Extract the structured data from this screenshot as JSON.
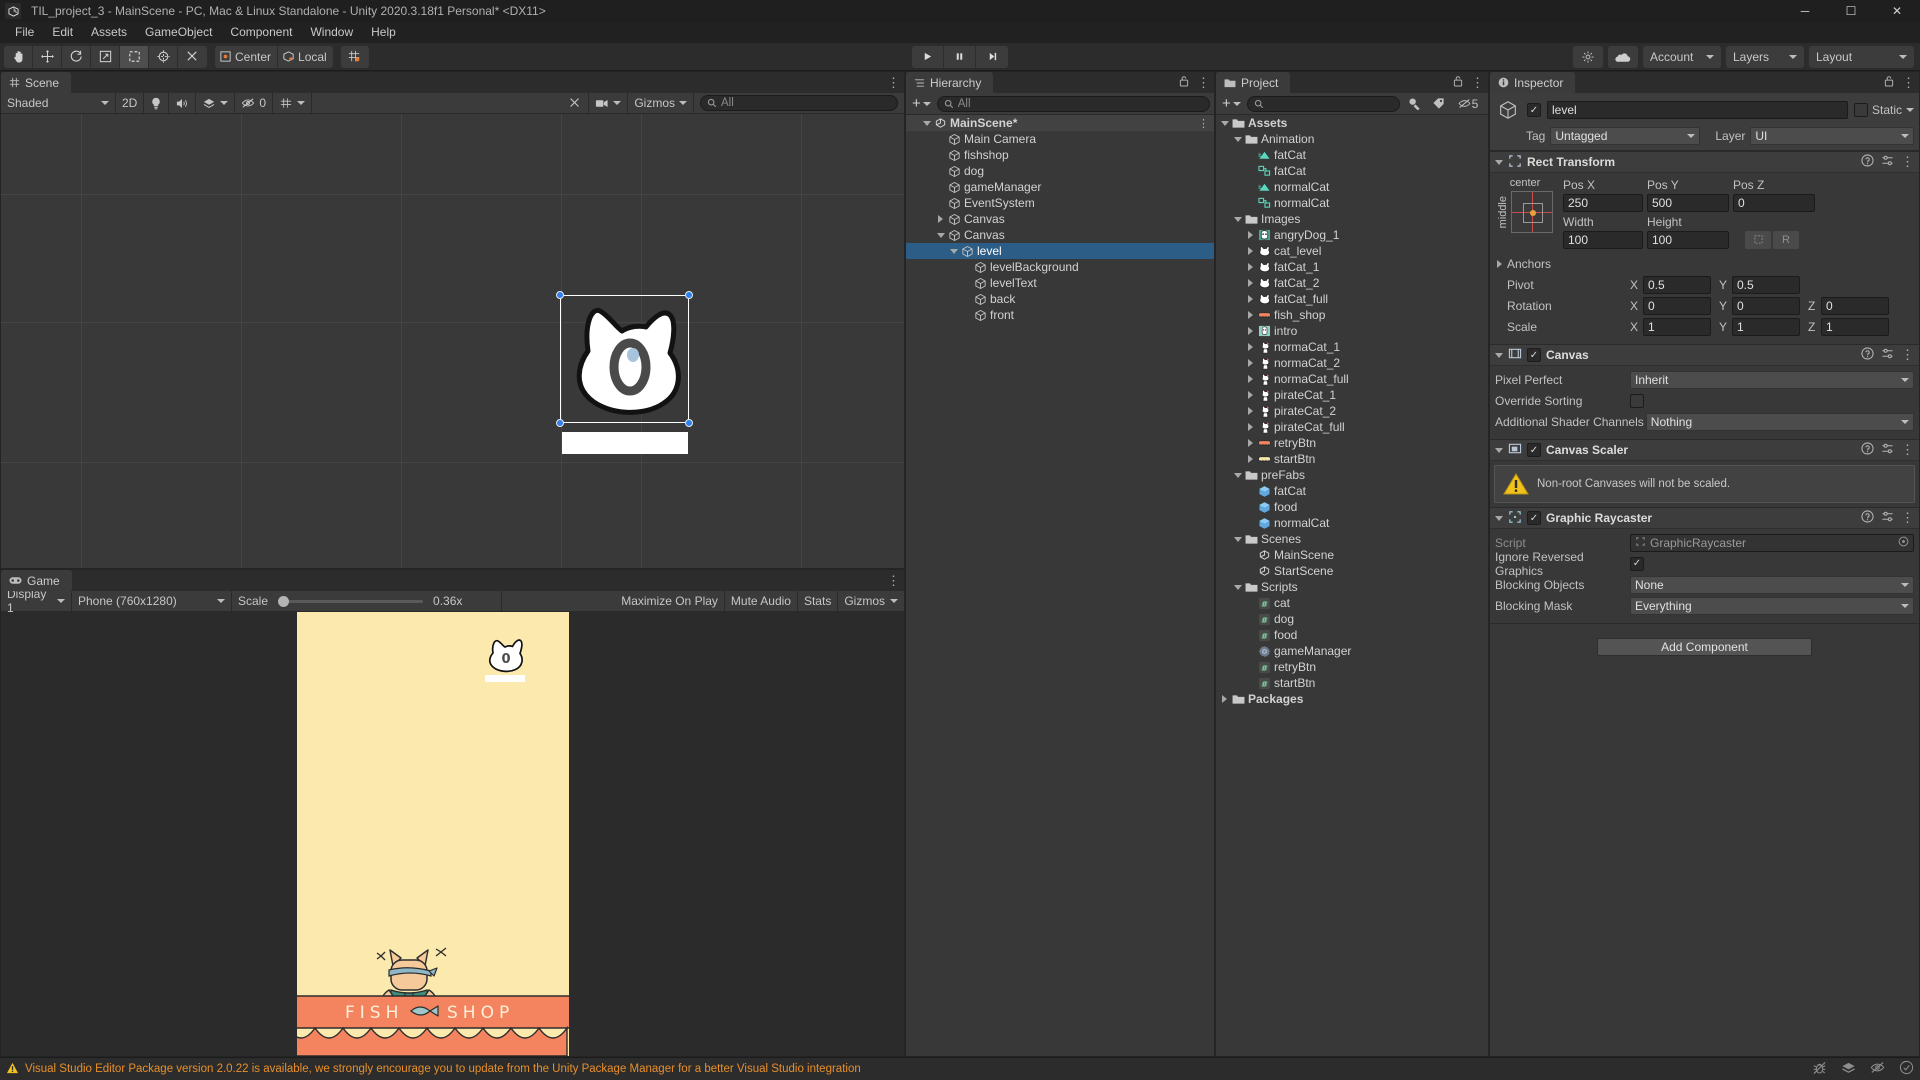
{
  "window": {
    "title": "TIL_project_3 - MainScene - PC, Mac & Linux Standalone - Unity 2020.3.18f1 Personal* <DX11>",
    "minimize": "─",
    "maximize": "☐",
    "close": "✕"
  },
  "menubar": {
    "items": [
      "File",
      "Edit",
      "Assets",
      "GameObject",
      "Component",
      "Window",
      "Help"
    ]
  },
  "toolbar": {
    "tools": [
      {
        "name": "hand-tool",
        "glyph": "✋",
        "active": false
      },
      {
        "name": "move-tool",
        "glyph": "✥",
        "active": false
      },
      {
        "name": "rotate-tool",
        "glyph": "↻",
        "active": false
      },
      {
        "name": "scale-tool",
        "glyph": "⬈",
        "active": false
      },
      {
        "name": "rect-tool",
        "glyph": "⬚",
        "active": true
      },
      {
        "name": "transform-tool",
        "glyph": "⊕",
        "active": false
      },
      {
        "name": "custom-tool",
        "glyph": "⚒",
        "active": false
      }
    ],
    "pivot_mode": "Center",
    "pivot_rotation": "Local",
    "grid_snap": "grid-snap-icon",
    "play": "▶",
    "pause": "▐▌",
    "step": "▶│",
    "cloud": "☁",
    "account": "Account",
    "layers": "Layers",
    "layout": "Layout",
    "search_glyph": "●"
  },
  "scene": {
    "tab_label": "Scene",
    "tab_icon": "#",
    "draw_mode": "Shaded",
    "mode_2d": "2D",
    "lighting_icon": "💡",
    "audio_icon": "🔊",
    "fx_icon": "fx-icon",
    "hidden_count": "0",
    "grid_icon": "grid-icon",
    "tools_icon": "⚒",
    "camera_icon": "▮",
    "gizmos_label": "Gizmos",
    "search_placeholder": "All",
    "sprite_label": "0"
  },
  "game": {
    "tab_label": "Game",
    "display": "Display 1",
    "aspect": "Phone (760x1280)",
    "scale_label": "Scale",
    "scale_value": "0.36x",
    "maximize": "Maximize On Play",
    "mute": "Mute Audio",
    "stats": "Stats",
    "gizmos": "Gizmos",
    "cat_counter": "0",
    "shop_sign": "F I S H   S H O P"
  },
  "hierarchy": {
    "tab_label": "Hierarchy",
    "tab_icon": "☰",
    "search_placeholder": "All",
    "scene_name": "MainScene*",
    "items": [
      {
        "label": "Main Camera",
        "depth": 2,
        "icon": "gameobject-icon",
        "arrow": "none",
        "selected": false
      },
      {
        "label": "fishshop",
        "depth": 2,
        "icon": "gameobject-icon",
        "arrow": "none",
        "selected": false
      },
      {
        "label": "dog",
        "depth": 2,
        "icon": "gameobject-icon",
        "arrow": "none",
        "selected": false
      },
      {
        "label": "gameManager",
        "depth": 2,
        "icon": "gameobject-icon",
        "arrow": "none",
        "selected": false
      },
      {
        "label": "EventSystem",
        "depth": 2,
        "icon": "gameobject-icon",
        "arrow": "none",
        "selected": false
      },
      {
        "label": "Canvas",
        "depth": 2,
        "icon": "gameobject-icon",
        "arrow": "closed",
        "selected": false
      },
      {
        "label": "Canvas",
        "depth": 2,
        "icon": "gameobject-icon",
        "arrow": "open",
        "selected": false
      },
      {
        "label": "level",
        "depth": 3,
        "icon": "gameobject-icon",
        "arrow": "open",
        "selected": true
      },
      {
        "label": "levelBackground",
        "depth": 4,
        "icon": "gameobject-icon",
        "arrow": "none",
        "selected": false
      },
      {
        "label": "levelText",
        "depth": 4,
        "icon": "gameobject-icon",
        "arrow": "none",
        "selected": false
      },
      {
        "label": "back",
        "depth": 4,
        "icon": "gameobject-icon",
        "arrow": "none",
        "selected": false
      },
      {
        "label": "front",
        "depth": 4,
        "icon": "gameobject-icon",
        "arrow": "none",
        "selected": false
      }
    ]
  },
  "project": {
    "tab_label": "Project",
    "tab_icon": "🗀",
    "search_placeholder": "",
    "hidden_count": "5",
    "items": [
      {
        "label": "Assets",
        "depth": 0,
        "icon": "folder",
        "arrow": "open",
        "bold": true
      },
      {
        "label": "Animation",
        "depth": 1,
        "icon": "folder",
        "arrow": "open",
        "bold": false
      },
      {
        "label": "fatCat",
        "depth": 2,
        "icon": "anim-clip",
        "arrow": "none",
        "bold": false
      },
      {
        "label": "fatCat",
        "depth": 2,
        "icon": "anim-ctrl",
        "arrow": "none",
        "bold": false
      },
      {
        "label": "normalCat",
        "depth": 2,
        "icon": "anim-clip",
        "arrow": "none",
        "bold": false
      },
      {
        "label": "normalCat",
        "depth": 2,
        "icon": "anim-ctrl",
        "arrow": "none",
        "bold": false
      },
      {
        "label": "Images",
        "depth": 1,
        "icon": "folder",
        "arrow": "open",
        "bold": false
      },
      {
        "label": "angryDog_1",
        "depth": 2,
        "icon": "tex-dog",
        "arrow": "closed",
        "bold": false
      },
      {
        "label": "cat_level",
        "depth": 2,
        "icon": "tex-catw",
        "arrow": "closed",
        "bold": false
      },
      {
        "label": "fatCat_1",
        "depth": 2,
        "icon": "tex-catw",
        "arrow": "closed",
        "bold": false
      },
      {
        "label": "fatCat_2",
        "depth": 2,
        "icon": "tex-catw",
        "arrow": "closed",
        "bold": false
      },
      {
        "label": "fatCat_full",
        "depth": 2,
        "icon": "tex-catw",
        "arrow": "closed",
        "bold": false
      },
      {
        "label": "fish_shop",
        "depth": 2,
        "icon": "tex-bar-o",
        "arrow": "closed",
        "bold": false
      },
      {
        "label": "intro",
        "depth": 2,
        "icon": "tex-intro",
        "arrow": "closed",
        "bold": false
      },
      {
        "label": "normaCat_1",
        "depth": 2,
        "icon": "tex-cat",
        "arrow": "closed",
        "bold": false
      },
      {
        "label": "normaCat_2",
        "depth": 2,
        "icon": "tex-cat",
        "arrow": "closed",
        "bold": false
      },
      {
        "label": "normaCat_full",
        "depth": 2,
        "icon": "tex-cat",
        "arrow": "closed",
        "bold": false
      },
      {
        "label": "pirateCat_1",
        "depth": 2,
        "icon": "tex-cat",
        "arrow": "closed",
        "bold": false
      },
      {
        "label": "pirateCat_2",
        "depth": 2,
        "icon": "tex-cat",
        "arrow": "closed",
        "bold": false
      },
      {
        "label": "pirateCat_full",
        "depth": 2,
        "icon": "tex-cat",
        "arrow": "closed",
        "bold": false
      },
      {
        "label": "retryBtn",
        "depth": 2,
        "icon": "tex-bar-o",
        "arrow": "closed",
        "bold": false
      },
      {
        "label": "startBtn",
        "depth": 2,
        "icon": "tex-bar-y",
        "arrow": "closed",
        "bold": false
      },
      {
        "label": "preFabs",
        "depth": 1,
        "icon": "folder",
        "arrow": "open",
        "bold": false
      },
      {
        "label": "fatCat",
        "depth": 2,
        "icon": "prefab",
        "arrow": "none",
        "bold": false
      },
      {
        "label": "food",
        "depth": 2,
        "icon": "prefab",
        "arrow": "none",
        "bold": false
      },
      {
        "label": "normalCat",
        "depth": 2,
        "icon": "prefab",
        "arrow": "none",
        "bold": false
      },
      {
        "label": "Scenes",
        "depth": 1,
        "icon": "folder",
        "arrow": "open",
        "bold": false
      },
      {
        "label": "MainScene",
        "depth": 2,
        "icon": "scene",
        "arrow": "none",
        "bold": false
      },
      {
        "label": "StartScene",
        "depth": 2,
        "icon": "scene",
        "arrow": "none",
        "bold": false
      },
      {
        "label": "Scripts",
        "depth": 1,
        "icon": "folder",
        "arrow": "open",
        "bold": false
      },
      {
        "label": "cat",
        "depth": 2,
        "icon": "script",
        "arrow": "none",
        "bold": false
      },
      {
        "label": "dog",
        "depth": 2,
        "icon": "script",
        "arrow": "none",
        "bold": false
      },
      {
        "label": "food",
        "depth": 2,
        "icon": "script",
        "arrow": "none",
        "bold": false
      },
      {
        "label": "gameManager",
        "depth": 2,
        "icon": "gear",
        "arrow": "none",
        "bold": false
      },
      {
        "label": "retryBtn",
        "depth": 2,
        "icon": "script",
        "arrow": "none",
        "bold": false
      },
      {
        "label": "startBtn",
        "depth": 2,
        "icon": "script",
        "arrow": "none",
        "bold": false
      },
      {
        "label": "Packages",
        "depth": 0,
        "icon": "folder",
        "arrow": "closed",
        "bold": true
      }
    ]
  },
  "inspector": {
    "tab_label": "Inspector",
    "tab_icon": "ℹ",
    "object_name": "level",
    "enabled": true,
    "static_label": "Static",
    "tag_label": "Tag",
    "tag_value": "Untagged",
    "layer_label": "Layer",
    "layer_value": "UI",
    "rect_transform": {
      "title": "Rect Transform",
      "anchor_preset_top": "center",
      "anchor_preset_side": "middle",
      "pos_x_label": "Pos X",
      "pos_x": "250",
      "pos_y_label": "Pos Y",
      "pos_y": "500",
      "pos_z_label": "Pos Z",
      "pos_z": "0",
      "width_label": "Width",
      "width": "100",
      "height_label": "Height",
      "height": "100",
      "blueprint_btn": "blueprint-mode-icon",
      "raw_btn": "R",
      "anchors_label": "Anchors",
      "pivot_label": "Pivot",
      "pivot_x": "0.5",
      "pivot_y": "0.5",
      "rotation_label": "Rotation",
      "rot_x": "0",
      "rot_y": "0",
      "rot_z": "0",
      "scale_label": "Scale",
      "scale_x": "1",
      "scale_y": "1",
      "scale_z": "1"
    },
    "canvas": {
      "title": "Canvas",
      "enabled": true,
      "pixel_perfect_label": "Pixel Perfect",
      "pixel_perfect": "Inherit",
      "override_sorting_label": "Override Sorting",
      "override_sorting": false,
      "shader_channels_label": "Additional Shader Channels",
      "shader_channels": "Nothing"
    },
    "canvas_scaler": {
      "title": "Canvas Scaler",
      "enabled": true,
      "warning": "Non-root Canvases will not be scaled."
    },
    "graphic_raycaster": {
      "title": "Graphic Raycaster",
      "enabled": true,
      "script_label": "Script",
      "script_value": "GraphicRaycaster",
      "ignore_label": "Ignore Reversed Graphics",
      "ignore_value": true,
      "blocking_objects_label": "Blocking Objects",
      "blocking_objects": "None",
      "blocking_mask_label": "Blocking Mask",
      "blocking_mask": "Everything"
    },
    "add_component": "Add Component"
  },
  "status": {
    "message": "Visual Studio Editor Package version 2.0.22 is available, we strongly encourage you to update from the Unity Package Manager for a better Visual Studio integration",
    "warn_icon": "⚠",
    "right_icons": [
      "bug-icon",
      "layers-icon",
      "eye-off-icon",
      "check-circle-icon"
    ]
  },
  "colors": {
    "accent_blue": "#2c5d87",
    "handle_blue": "#2f80ed",
    "warn_orange": "#e88f2a",
    "game_bg": "#fce9ae",
    "shop_orange": "#f4845f"
  }
}
